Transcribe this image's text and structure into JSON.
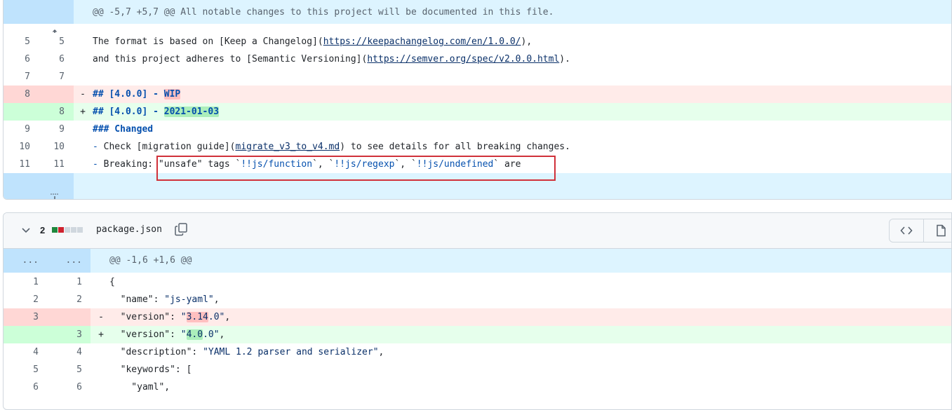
{
  "file1": {
    "hunk_header": "@@ -5,7 +5,7 @@ All notable changes to this project will be documented in this file.",
    "lines": [
      {
        "old": "5",
        "new": "5",
        "segments": [
          {
            "t": "The format is based on [Keep a Changelog]("
          },
          {
            "t": "https://keepachangelog.com/en/1.0.0/",
            "c": "url"
          },
          {
            "t": "),"
          }
        ]
      },
      {
        "old": "6",
        "new": "6",
        "segments": [
          {
            "t": "and this project adheres to [Semantic Versioning]("
          },
          {
            "t": "https://semver.org/spec/v2.0.0.html",
            "c": "url"
          },
          {
            "t": ")."
          }
        ]
      },
      {
        "old": "7",
        "new": "7",
        "segments": []
      },
      {
        "old": "8",
        "new": "",
        "sign": "-",
        "type": "del",
        "segments": [
          {
            "t": "## [4.0.0] - ",
            "c": "kw"
          },
          {
            "t": "WIP",
            "c": "kw hl-del"
          }
        ]
      },
      {
        "old": "",
        "new": "8",
        "sign": "+",
        "type": "add",
        "segments": [
          {
            "t": "## [4.0.0] - ",
            "c": "kw"
          },
          {
            "t": "2021-01-03",
            "c": "kw hl-add"
          }
        ]
      },
      {
        "old": "9",
        "new": "9",
        "segments": [
          {
            "t": "### Changed",
            "c": "kw"
          }
        ]
      },
      {
        "old": "10",
        "new": "10",
        "segments": [
          {
            "t": "- ",
            "c": "lbl"
          },
          {
            "t": "Check [migration guide]("
          },
          {
            "t": "migrate_v3_to_v4.md",
            "c": "url"
          },
          {
            "t": ") to see details for all breaking changes."
          }
        ]
      },
      {
        "old": "11",
        "new": "11",
        "segments": [
          {
            "t": "- ",
            "c": "lbl"
          },
          {
            "t": "Breaking: \"unsafe\" tags `"
          },
          {
            "t": "!!js/function",
            "c": "lbl"
          },
          {
            "t": "`, `"
          },
          {
            "t": "!!js/regexp",
            "c": "lbl"
          },
          {
            "t": "`, `"
          },
          {
            "t": "!!js/undefined",
            "c": "lbl"
          },
          {
            "t": "` are"
          }
        ]
      }
    ]
  },
  "file2": {
    "changes_count": "2",
    "diffstat_colors": [
      "#1f883d",
      "#cf222e",
      "#d0d7de",
      "#d0d7de",
      "#d0d7de"
    ],
    "filename": "package.json",
    "hunk_old": "...",
    "hunk_new": "...",
    "hunk_header": "@@ -1,6 +1,6 @@",
    "lines": [
      {
        "old": "1",
        "new": "1",
        "segments": [
          {
            "t": "{"
          }
        ]
      },
      {
        "old": "2",
        "new": "2",
        "segments": [
          {
            "t": "  \"name\""
          },
          {
            "t": ": "
          },
          {
            "t": "\"js-yaml\"",
            "c": "str"
          },
          {
            "t": ","
          }
        ]
      },
      {
        "old": "3",
        "new": "",
        "sign": "-",
        "type": "del",
        "segments": [
          {
            "t": "  \"version\""
          },
          {
            "t": ": "
          },
          {
            "t": "\"",
            "c": "str"
          },
          {
            "t": "3.14",
            "c": "str hl-del"
          },
          {
            "t": ".0\"",
            "c": "str"
          },
          {
            "t": ","
          }
        ]
      },
      {
        "old": "",
        "new": "3",
        "sign": "+",
        "type": "add",
        "segments": [
          {
            "t": "  \"version\""
          },
          {
            "t": ": "
          },
          {
            "t": "\"",
            "c": "str"
          },
          {
            "t": "4.0",
            "c": "str hl-add"
          },
          {
            "t": ".0\"",
            "c": "str"
          },
          {
            "t": ","
          }
        ]
      },
      {
        "old": "4",
        "new": "4",
        "segments": [
          {
            "t": "  \"description\""
          },
          {
            "t": ": "
          },
          {
            "t": "\"YAML 1.2 parser and serializer\"",
            "c": "str"
          },
          {
            "t": ","
          }
        ]
      },
      {
        "old": "5",
        "new": "5",
        "segments": [
          {
            "t": "  \"keywords\""
          },
          {
            "t": ": ["
          }
        ]
      },
      {
        "old": "6",
        "new": "6",
        "segments": [
          {
            "t": "    \"yaml\""
          },
          {
            "t": ","
          }
        ]
      }
    ]
  },
  "icons": {
    "expand_up": "expand-up-icon",
    "expand_down": "expand-down-icon",
    "chevron": "chevron-down-icon",
    "copy": "copy-icon",
    "code": "code-icon",
    "file": "file-icon"
  }
}
